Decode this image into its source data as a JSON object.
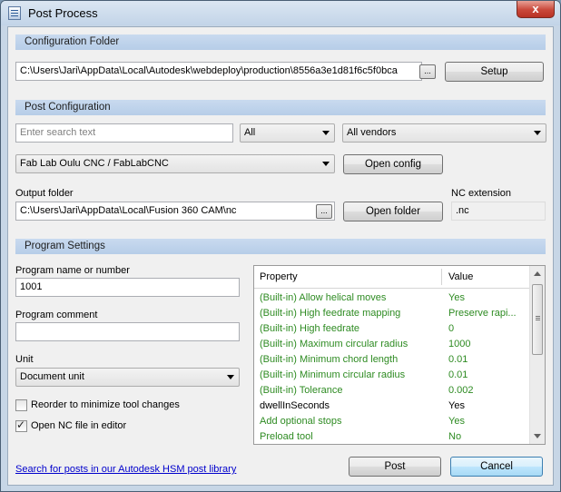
{
  "window": {
    "title": "Post Process",
    "close_glyph": "x"
  },
  "config_folder": {
    "header": "Configuration Folder",
    "path": "C:\\Users\\Jari\\AppData\\Local\\Autodesk\\webdeploy\\production\\8556a3e1d81f6c5f0bca",
    "browse_label": "...",
    "setup_label": "Setup"
  },
  "post_config": {
    "header": "Post Configuration",
    "search_placeholder": "Enter search text",
    "filter_selected": "All",
    "vendor_selected": "All vendors",
    "post_selected": "Fab Lab Oulu CNC / FabLabCNC",
    "open_config_label": "Open config",
    "output_folder_label": "Output folder",
    "output_folder_path": "C:\\Users\\Jari\\AppData\\Local\\Fusion 360 CAM\\nc",
    "output_browse_label": "...",
    "open_folder_label": "Open folder",
    "nc_extension_label": "NC extension",
    "nc_extension_value": ".nc"
  },
  "program_settings": {
    "header": "Program Settings",
    "program_name_label": "Program name or number",
    "program_name_value": "1001",
    "program_comment_label": "Program comment",
    "program_comment_value": "",
    "unit_label": "Unit",
    "unit_selected": "Document unit",
    "reorder_label": "Reorder to minimize tool changes",
    "reorder_checked": false,
    "open_nc_label": "Open NC file in editor",
    "open_nc_checked": true
  },
  "property_table": {
    "columns": [
      "Property",
      "Value"
    ],
    "rows": [
      {
        "property": "(Built-in) Allow helical moves",
        "value": "Yes",
        "color": "#2e8b22"
      },
      {
        "property": "(Built-in) High feedrate mapping",
        "value": "Preserve rapi...",
        "color": "#2e8b22"
      },
      {
        "property": "(Built-in) High feedrate",
        "value": "0",
        "color": "#2e8b22"
      },
      {
        "property": "(Built-in) Maximum circular radius",
        "value": "1000",
        "color": "#2e8b22"
      },
      {
        "property": "(Built-in) Minimum chord length",
        "value": "0.01",
        "color": "#2e8b22"
      },
      {
        "property": "(Built-in) Minimum circular radius",
        "value": "0.01",
        "color": "#2e8b22"
      },
      {
        "property": "(Built-in) Tolerance",
        "value": "0.002",
        "color": "#2e8b22"
      },
      {
        "property": "dwellInSeconds",
        "value": "Yes",
        "color": "#000000"
      },
      {
        "property": "Add optional stops",
        "value": "Yes",
        "color": "#2e8b22"
      },
      {
        "property": "Preload tool",
        "value": "No",
        "color": "#2e8b22"
      }
    ]
  },
  "footer": {
    "library_link": "Search for posts in our Autodesk HSM post library",
    "post_label": "Post",
    "cancel_label": "Cancel"
  },
  "colors": {
    "accent": "#3c7fb1",
    "section_header": "#c0d4ec",
    "built_in_text": "#2e8b22",
    "link": "#0000cc"
  }
}
